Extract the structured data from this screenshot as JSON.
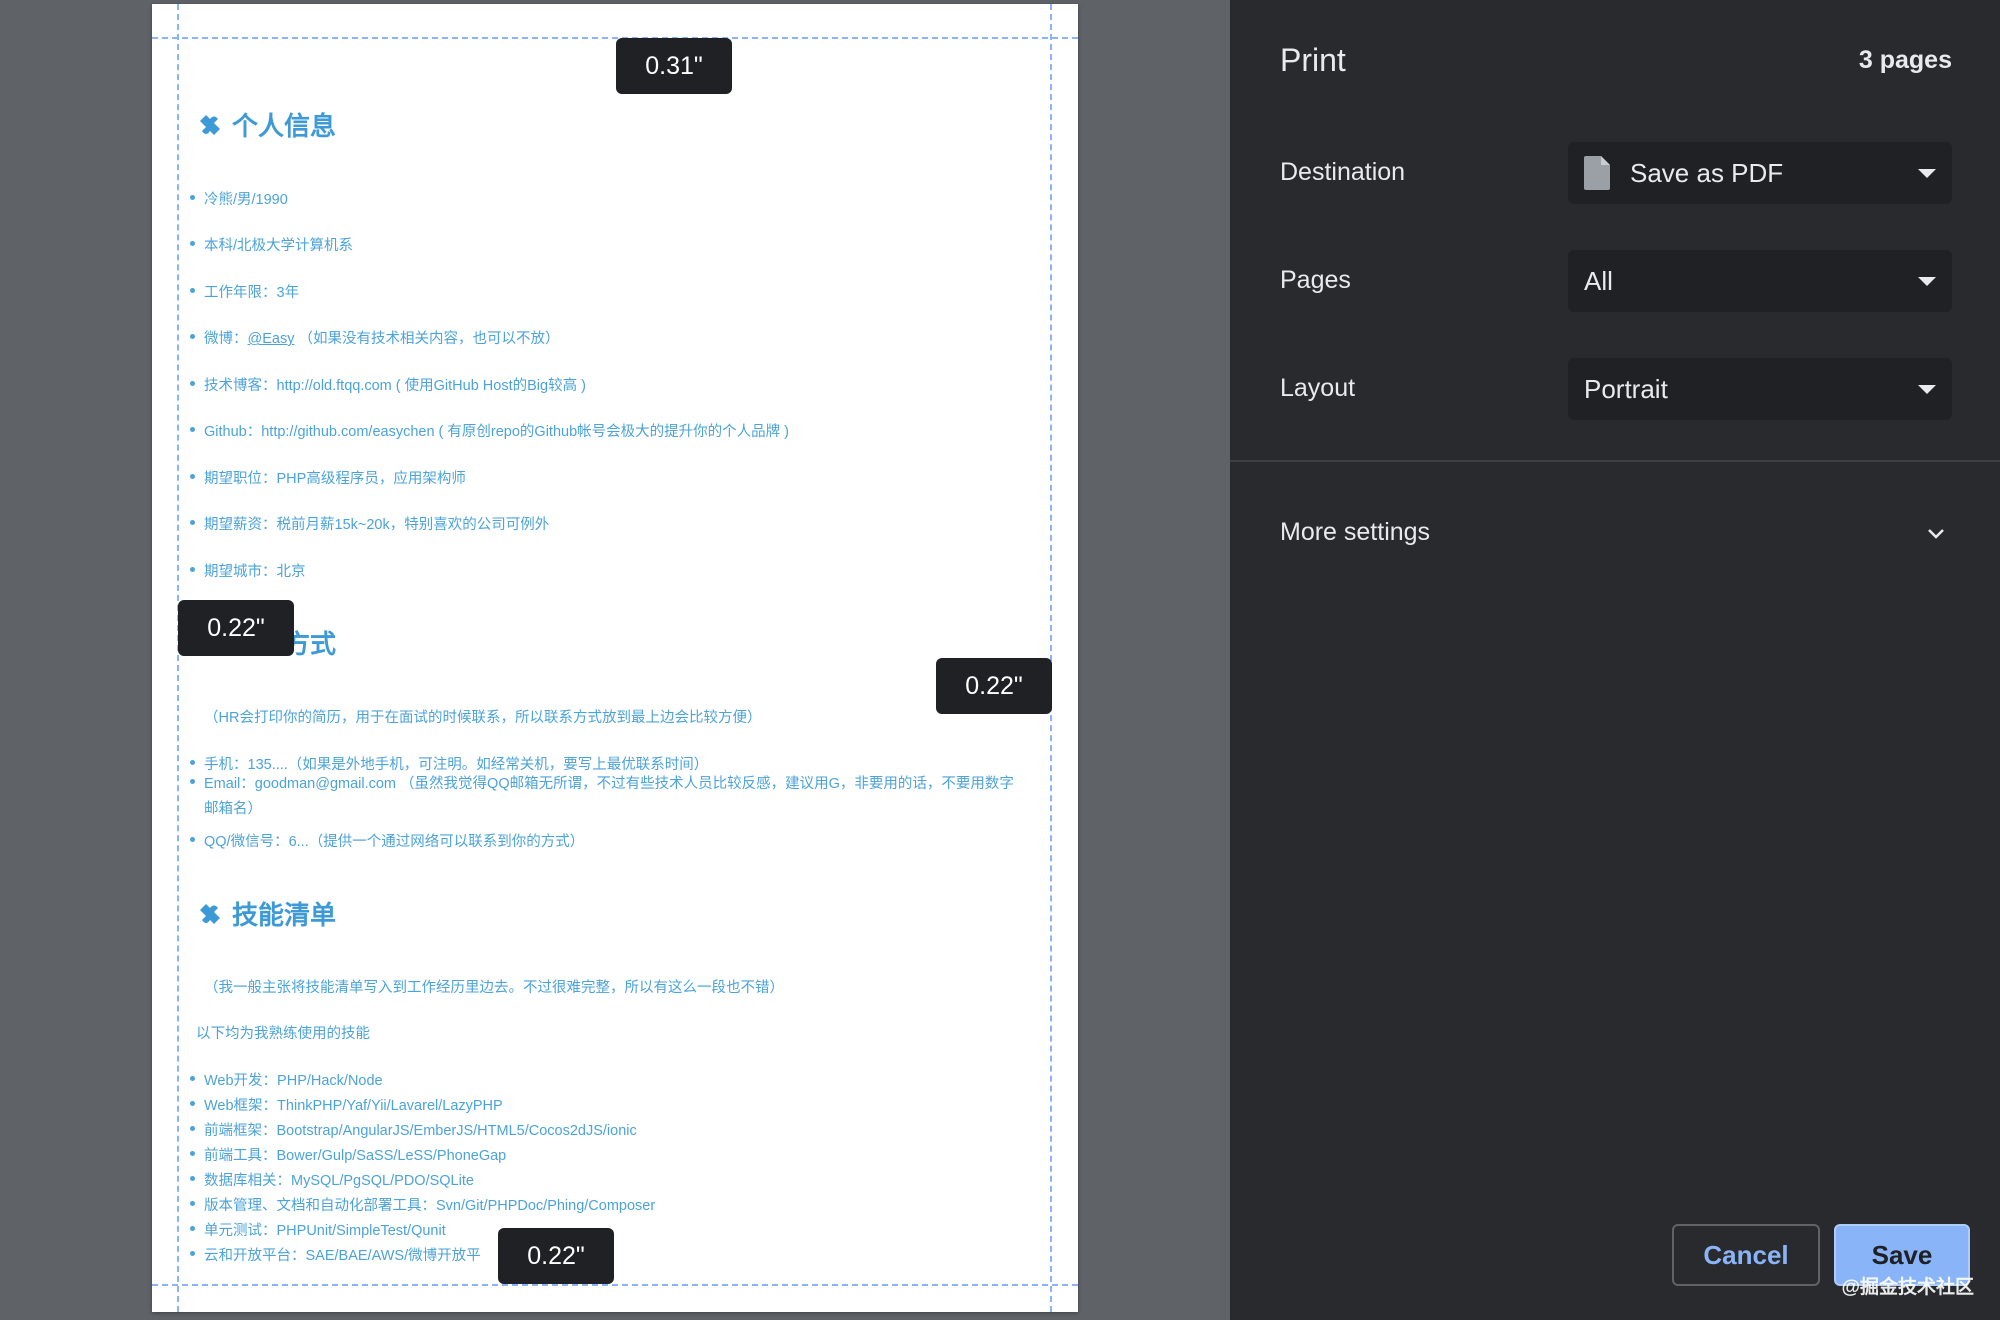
{
  "print_panel": {
    "title": "Print",
    "page_count": "3 pages",
    "destination": {
      "label": "Destination",
      "value": "Save as PDF"
    },
    "pages": {
      "label": "Pages",
      "value": "All"
    },
    "layout": {
      "label": "Layout",
      "value": "Portrait"
    },
    "more_settings": "More settings",
    "cancel_label": "Cancel",
    "save_label": "Save",
    "watermark": "@掘金技术社区"
  },
  "margins": {
    "top": "0.31\"",
    "left": "0.22\"",
    "right": "0.22\"",
    "bottom": "0.22\""
  },
  "document": {
    "section1": {
      "heading": "个人信息",
      "items": [
        "冷熊/男/1990",
        "本科/北极大学计算机系",
        "工作年限：3年",
        "技术博客：http://old.ftqq.com ( 使用GitHub Host的Big较高 )",
        "Github：http://github.com/easychen ( 有原创repo的Github帐号会极大的提升你的个人品牌 )",
        "期望职位：PHP高级程序员，应用架构师",
        "期望薪资：税前月薪15k~20k，特别喜欢的公司可例外",
        "期望城市：北京"
      ],
      "weibo_prefix": "微博：",
      "weibo_link": "@Easy",
      "weibo_suffix": "（如果没有技术相关内容，也可以不放）"
    },
    "section2": {
      "heading_visible": "方式",
      "intro": "（HR会打印你的简历，用于在面试的时候联系，所以联系方式放到最上边会比较方便）",
      "items": [
        "手机：135....（如果是外地手机，可注明。如经常关机，要写上最优联系时间）",
        "Email：goodman@gmail.com （虽然我觉得QQ邮箱无所谓，不过有些技术人员比较反感，建议用G，非要用的话，不要用数字邮箱名）",
        "QQ/微信号：6...（提供一个通过网络可以联系到你的方式）"
      ]
    },
    "section3": {
      "heading": "技能清单",
      "intro": "（我一般主张将技能清单写入到工作经历里边去。不过很难完整，所以有这么一段也不错）",
      "subintro": "以下均为我熟练使用的技能",
      "items": [
        "Web开发：PHP/Hack/Node",
        "Web框架：ThinkPHP/Yaf/Yii/Lavarel/LazyPHP",
        "前端框架：Bootstrap/AngularJS/EmberJS/HTML5/Cocos2dJS/ionic",
        "前端工具：Bower/Gulp/SaSS/LeSS/PhoneGap",
        "数据库相关：MySQL/PgSQL/PDO/SQLite",
        "版本管理、文档和自动化部署工具：Svn/Git/PHPDoc/Phing/Composer",
        "单元测试：PHPUnit/SimpleTest/Qunit",
        "云和开放平台：SAE/BAE/AWS/微博开放平"
      ]
    }
  },
  "icons": {
    "heading_icon": "puzzle-icon",
    "file_icon": "file-icon",
    "dropdown_icon": "caret-down-icon",
    "more_icon": "chevron-down-icon"
  },
  "colors": {
    "panel_bg": "#292a2d",
    "preview_bg": "#5f6368",
    "accent": "#8ab4f8",
    "doc_text": "#4ca3d9"
  }
}
